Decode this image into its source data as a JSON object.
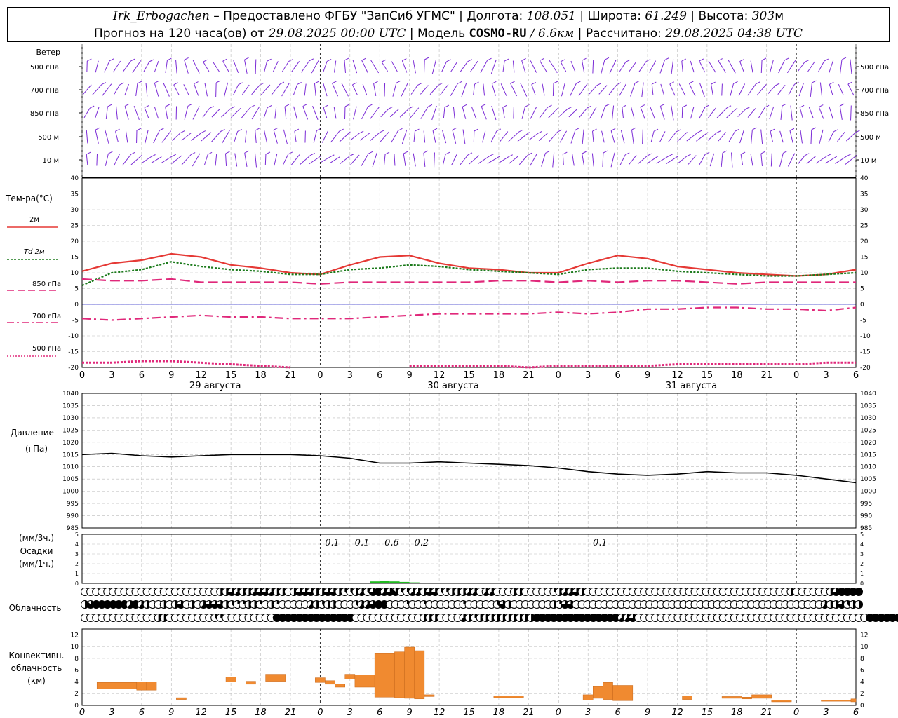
{
  "header": {
    "station": "Irk_Erbogachen",
    "dash": "–",
    "provider": "Предоставлено ФГБУ \"ЗапСиб УГМС\"",
    "lon_label": "Долгота:",
    "lon_value": "108.051",
    "lat_label": "Широта:",
    "lat_value": "61.249",
    "alt_label": "Высота:",
    "alt_value": "303",
    "alt_unit": "м",
    "forecast_prefix": "Прогноз на 120 часа(ов) от",
    "forecast_start": "29.08.2025 00:00 UTC",
    "model_label": "Модель",
    "model_name": "COSMO-RU",
    "model_res": "/ 6.6км",
    "calc_label": "Рассчитано:",
    "calc_time": "29.08.2025 04:38 UTC"
  },
  "wind": {
    "title": "Ветер",
    "levels": [
      "500 гПа",
      "700 гПа",
      "850 гПа",
      "500 м",
      "10  м"
    ],
    "color": "#7b2bd6"
  },
  "time_axis": {
    "hour_ticks": [
      "0",
      "3",
      "6",
      "9",
      "12",
      "15",
      "18",
      "21",
      "0",
      "3",
      "6",
      "9",
      "12",
      "15",
      "18",
      "21",
      "0",
      "3",
      "6",
      "9",
      "12",
      "15",
      "18",
      "21",
      "0",
      "3",
      "6"
    ],
    "days": [
      "29 августа",
      "30 августа",
      "31 августа"
    ]
  },
  "chart_data": [
    {
      "type": "line",
      "panel": "temperature",
      "title": "Тем-ра(°C)",
      "ylim": [
        -20,
        40
      ],
      "yticks": [
        -20,
        -15,
        -10,
        -5,
        0,
        5,
        10,
        15,
        20,
        25,
        30,
        35,
        40
      ],
      "x_hours": [
        0,
        3,
        6,
        9,
        12,
        15,
        18,
        21,
        24,
        27,
        30,
        33,
        36,
        39,
        42,
        45,
        48,
        51,
        54,
        57,
        60,
        63,
        66,
        69,
        72,
        75,
        78
      ],
      "series": [
        {
          "name": "2м",
          "color": "#e53935",
          "style": "solid",
          "values": [
            10.5,
            13,
            14,
            16,
            15,
            12.5,
            11.5,
            10,
            9.5,
            12.5,
            15,
            15.5,
            13,
            11.5,
            11,
            10,
            10,
            13,
            15.5,
            14.5,
            12,
            11,
            10,
            9.5,
            9,
            9.5,
            11
          ]
        },
        {
          "name": "Td 2м",
          "color": "#1b7a1b",
          "style": "dotted",
          "values": [
            6,
            10,
            11,
            13.5,
            12,
            11,
            10.5,
            9.5,
            9.5,
            11,
            11.5,
            12.5,
            12,
            11,
            10.5,
            10,
            9.5,
            11,
            11.5,
            11.5,
            10.5,
            10,
            9.5,
            9,
            9,
            9.5,
            10
          ]
        },
        {
          "name": "850 гПа",
          "color": "#e0287a",
          "style": "dashed",
          "values": [
            8,
            7.5,
            7.5,
            8,
            7,
            7,
            7,
            7,
            6.5,
            7,
            7,
            7,
            7,
            7,
            7.5,
            7.5,
            7,
            7.5,
            7,
            7.5,
            7.5,
            7,
            6.5,
            7,
            7,
            7,
            7
          ]
        },
        {
          "name": "700 гПа",
          "color": "#e0287a",
          "style": "dashdot",
          "values": [
            -4.5,
            -5,
            -4.5,
            -4,
            -3.5,
            -4,
            -4,
            -4.5,
            -4.5,
            -4.5,
            -4,
            -3.5,
            -3,
            -3,
            -3,
            -3,
            -2.5,
            -3,
            -2.5,
            -1.5,
            -1.5,
            -1,
            -1,
            -1.5,
            -1.5,
            -2,
            -1
          ]
        },
        {
          "name": "500 гПа",
          "color": "#e0287a",
          "style": "dotted-thick",
          "values": [
            -18.5,
            -18.5,
            -18,
            -18,
            -18.5,
            -19,
            -19.5,
            -20,
            null,
            null,
            null,
            -19.5,
            -19.5,
            -19.5,
            -19.5,
            -20,
            -19.5,
            -19.5,
            -19.5,
            -19.5,
            -19,
            -19,
            -19,
            -19,
            -19,
            -18.5,
            -18.5
          ]
        }
      ]
    },
    {
      "type": "line",
      "panel": "pressure",
      "title": "Давление",
      "ylabel": "(гПа)",
      "ylim": [
        985,
        1040
      ],
      "yticks": [
        985,
        990,
        995,
        1000,
        1005,
        1010,
        1015,
        1020,
        1025,
        1030,
        1035,
        1040
      ],
      "x_hours": [
        0,
        3,
        6,
        9,
        12,
        15,
        18,
        21,
        24,
        27,
        30,
        33,
        36,
        39,
        42,
        45,
        48,
        51,
        54,
        57,
        60,
        63,
        66,
        69,
        72,
        75,
        78
      ],
      "series": [
        {
          "name": "",
          "color": "#000000",
          "values": [
            1015,
            1015.5,
            1014.5,
            1014,
            1014.5,
            1015,
            1015,
            1015,
            1014.5,
            1013.5,
            1011.5,
            1011.5,
            1012,
            1011.5,
            1011,
            1010.5,
            1009.5,
            1008,
            1007,
            1006.5,
            1007,
            1008,
            1007.5,
            1007.5,
            1006.5,
            1005,
            1003.5
          ]
        }
      ]
    },
    {
      "type": "bar",
      "panel": "precipitation",
      "title": "Осадки",
      "ylabel_top": "(мм/3ч.)",
      "ylabel_bottom": "(мм/1ч.)",
      "ylim": [
        0,
        5
      ],
      "yticks": [
        0,
        1,
        2,
        3,
        4,
        5
      ],
      "labels": [
        {
          "hour": 25.5,
          "text": "0.1"
        },
        {
          "hour": 28.5,
          "text": "0.1"
        },
        {
          "hour": 31.5,
          "text": "0.6"
        },
        {
          "hour": 34.5,
          "text": "0.2"
        },
        {
          "hour": 52.5,
          "text": "0.1"
        }
      ],
      "bars_1h": [
        {
          "hour": 26,
          "value": 0.05
        },
        {
          "hour": 27,
          "value": 0.05
        },
        {
          "hour": 28,
          "value": 0.05
        },
        {
          "hour": 30,
          "value": 0.2
        },
        {
          "hour": 31,
          "value": 0.25
        },
        {
          "hour": 32,
          "value": 0.2
        },
        {
          "hour": 33,
          "value": 0.15
        },
        {
          "hour": 34,
          "value": 0.1
        },
        {
          "hour": 35,
          "value": 0.05
        },
        {
          "hour": 52,
          "value": 0.05
        },
        {
          "hour": 53,
          "value": 0.05
        }
      ],
      "color": "#22bb22"
    },
    {
      "type": "table",
      "panel": "cloudiness",
      "title": "Облачность",
      "rows_octas": [
        [
          0,
          0,
          0,
          0,
          0,
          0,
          0,
          0,
          0,
          0,
          0,
          0,
          0,
          0,
          0,
          0,
          0,
          0,
          0,
          0,
          0,
          0,
          0,
          0,
          4,
          4,
          6,
          5,
          4,
          4,
          5,
          6,
          6,
          5,
          4,
          4,
          0,
          4,
          6,
          6,
          6,
          4,
          4,
          6,
          6,
          4,
          3,
          3,
          4,
          5,
          3,
          6,
          8,
          5,
          6,
          7,
          3,
          3,
          5,
          5,
          4,
          6,
          6,
          3,
          3,
          4,
          4,
          4,
          5,
          5,
          0,
          5,
          5,
          0,
          0,
          0,
          4,
          4,
          0,
          0,
          0,
          0,
          0,
          2,
          4,
          5,
          5,
          6,
          4,
          0,
          0,
          0,
          0,
          0,
          0,
          0,
          0,
          0,
          0,
          0,
          0,
          0,
          0,
          0,
          0,
          0,
          0,
          0,
          0,
          0,
          0,
          0,
          0,
          0,
          0,
          0,
          0,
          0,
          0,
          0,
          0,
          0,
          0,
          0,
          0,
          4,
          0,
          0,
          0,
          0,
          0,
          0,
          4,
          6,
          8,
          8,
          8,
          8
        ],
        [
          4,
          7,
          8,
          8,
          8,
          8,
          8,
          8,
          5,
          8,
          5,
          4,
          0,
          0,
          4,
          0,
          4,
          6,
          0,
          4,
          0,
          5,
          6,
          6,
          6,
          4,
          3,
          2,
          2,
          4,
          4,
          2,
          0,
          4,
          2,
          0,
          0,
          0,
          0,
          0,
          5,
          4,
          3,
          4,
          4,
          0,
          0,
          0,
          3,
          5,
          5,
          6,
          8,
          8,
          0,
          0,
          0,
          2,
          0,
          0,
          2,
          0,
          0,
          0,
          0,
          0,
          0,
          2,
          0,
          0,
          0,
          0,
          0,
          3,
          6,
          4,
          0,
          0,
          0,
          0,
          0,
          0,
          0,
          4,
          2,
          6,
          6,
          0,
          0,
          0,
          0,
          0,
          0,
          0,
          0,
          0,
          0,
          0,
          0,
          0,
          0,
          0,
          0,
          0,
          0,
          0,
          0,
          0,
          0,
          0,
          0,
          0,
          0,
          0,
          0,
          0,
          0,
          0,
          0,
          0,
          0,
          0,
          0,
          0,
          0,
          0,
          0,
          0,
          0,
          0,
          0,
          5,
          4,
          4,
          6,
          3,
          4,
          4
        ],
        [
          0,
          0,
          0,
          0,
          0,
          0,
          0,
          0,
          0,
          0,
          0,
          0,
          0,
          4,
          4,
          0,
          0,
          0,
          0,
          0,
          0,
          0,
          0,
          3,
          3,
          0,
          0,
          0,
          0,
          0,
          0,
          0,
          0,
          0,
          8,
          8,
          8,
          8,
          8,
          8,
          8,
          8,
          8,
          8,
          8,
          8,
          8,
          8,
          0,
          0,
          0,
          0,
          0,
          0,
          0,
          0,
          0,
          0,
          0,
          0,
          4,
          4,
          4,
          0,
          0,
          0,
          0,
          5,
          4,
          3,
          4,
          4,
          4,
          4,
          4,
          4,
          4,
          4,
          4,
          4,
          8,
          8,
          8,
          8,
          8,
          8,
          8,
          8,
          8,
          8,
          8,
          8,
          8,
          8,
          8,
          5,
          5,
          6,
          0,
          0,
          0,
          0,
          0,
          0,
          0,
          0,
          0,
          0,
          0,
          0,
          0,
          0,
          0,
          0,
          0,
          0,
          0,
          0,
          0,
          0,
          0,
          0,
          0,
          0,
          0,
          0,
          0,
          0,
          0,
          0,
          0,
          0,
          0,
          0,
          0,
          0,
          0,
          0,
          0,
          8,
          8,
          8,
          8,
          8,
          8,
          8,
          8,
          8,
          8,
          8,
          8,
          8,
          8,
          8
        ]
      ]
    },
    {
      "type": "bar",
      "panel": "convective",
      "title_lines": [
        "Конвективн.",
        "облачность",
        "(км)"
      ],
      "ylim": [
        0,
        13
      ],
      "yticks": [
        0,
        2,
        4,
        6,
        8,
        10,
        12
      ],
      "color": "#f08a30",
      "ranges": [
        {
          "h0": 1.5,
          "h1": 5.5,
          "bottom": 2.8,
          "top": 3.9
        },
        {
          "h0": 5.5,
          "h1": 6.5,
          "bottom": 2.6,
          "top": 4.0
        },
        {
          "h0": 6.5,
          "h1": 7.5,
          "bottom": 2.6,
          "top": 4.0
        },
        {
          "h0": 9.5,
          "h1": 10.5,
          "bottom": 1.0,
          "top": 1.3
        },
        {
          "h0": 14.5,
          "h1": 15.5,
          "bottom": 4.0,
          "top": 4.8
        },
        {
          "h0": 16.5,
          "h1": 17.5,
          "bottom": 3.6,
          "top": 4.1
        },
        {
          "h0": 18.5,
          "h1": 20.5,
          "bottom": 4.1,
          "top": 5.3
        },
        {
          "h0": 23.5,
          "h1": 24.5,
          "bottom": 3.9,
          "top": 4.7
        },
        {
          "h0": 24.5,
          "h1": 25.5,
          "bottom": 3.6,
          "top": 4.2
        },
        {
          "h0": 25.5,
          "h1": 26.5,
          "bottom": 3.1,
          "top": 3.6
        },
        {
          "h0": 26.5,
          "h1": 27.5,
          "bottom": 4.5,
          "top": 5.3
        },
        {
          "h0": 27.5,
          "h1": 29.5,
          "bottom": 3.1,
          "top": 5.2
        },
        {
          "h0": 29.5,
          "h1": 31.5,
          "bottom": 1.4,
          "top": 8.8
        },
        {
          "h0": 31.5,
          "h1": 32.5,
          "bottom": 1.3,
          "top": 9.1
        },
        {
          "h0": 32.5,
          "h1": 33.5,
          "bottom": 1.2,
          "top": 9.9
        },
        {
          "h0": 33.5,
          "h1": 34.5,
          "bottom": 1.1,
          "top": 9.3
        },
        {
          "h0": 34.5,
          "h1": 35.5,
          "bottom": 1.5,
          "top": 1.8
        },
        {
          "h0": 41.5,
          "h1": 44.5,
          "bottom": 1.3,
          "top": 1.6
        },
        {
          "h0": 50.5,
          "h1": 51.5,
          "bottom": 0.9,
          "top": 1.8
        },
        {
          "h0": 51.5,
          "h1": 52.5,
          "bottom": 1.2,
          "top": 3.2
        },
        {
          "h0": 52.5,
          "h1": 53.5,
          "bottom": 1.0,
          "top": 3.9
        },
        {
          "h0": 53.5,
          "h1": 55.5,
          "bottom": 0.8,
          "top": 3.4
        },
        {
          "h0": 60.5,
          "h1": 61.5,
          "bottom": 1.0,
          "top": 1.6
        },
        {
          "h0": 64.5,
          "h1": 66.5,
          "bottom": 1.2,
          "top": 1.5
        },
        {
          "h0": 66.5,
          "h1": 67.5,
          "bottom": 1.1,
          "top": 1.4
        },
        {
          "h0": 67.5,
          "h1": 69.5,
          "bottom": 1.2,
          "top": 1.8
        },
        {
          "h0": 69.5,
          "h1": 71.5,
          "bottom": 0.6,
          "top": 0.9
        },
        {
          "h0": 74.5,
          "h1": 77.5,
          "bottom": 0.7,
          "top": 0.9
        },
        {
          "h0": 77.5,
          "h1": 78.0,
          "bottom": 0.6,
          "top": 1.1
        }
      ]
    }
  ]
}
